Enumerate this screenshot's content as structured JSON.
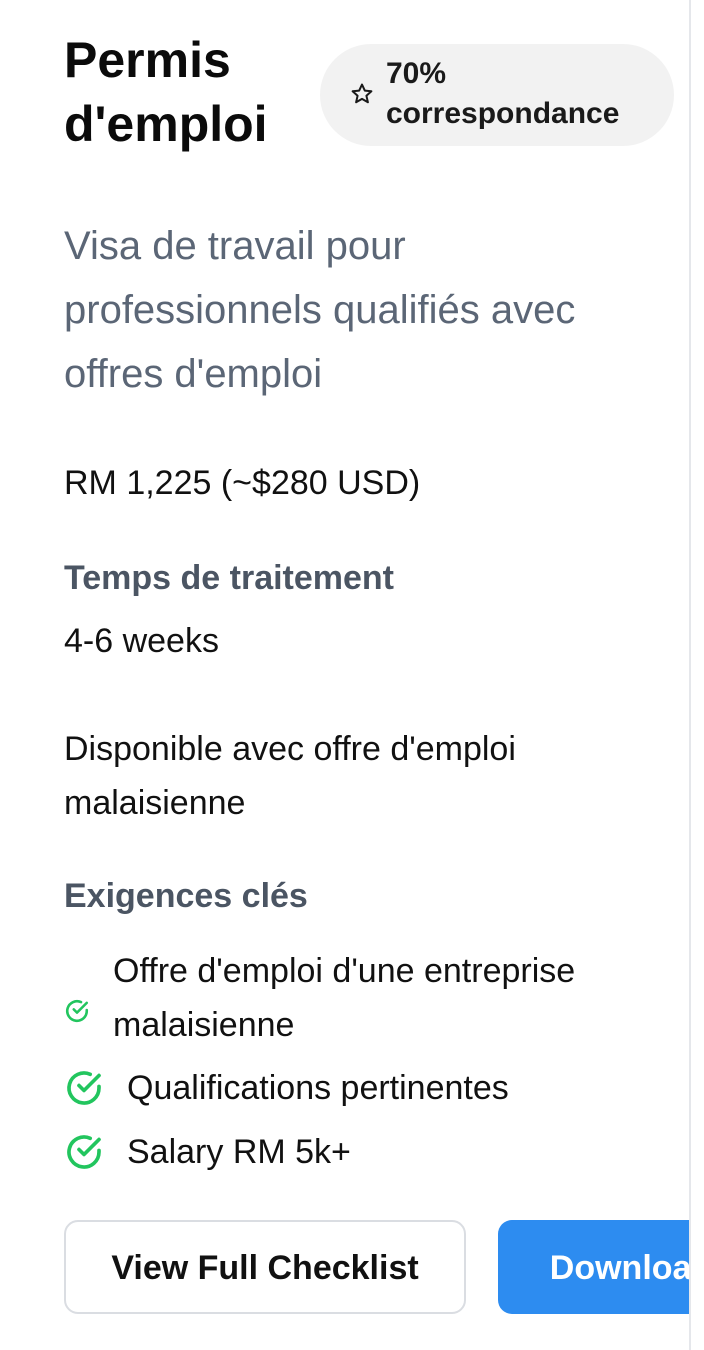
{
  "visa": {
    "title": "Permis d'emploi",
    "match": {
      "percent": "70%",
      "label": "correspondance",
      "icon": "star-icon"
    },
    "description": "Visa de travail pour professionnels qualifiés avec offres d'emploi",
    "cost": "RM 1,225 (~$280 USD)",
    "processing": {
      "label": "Temps de traitement",
      "value": "4-6 weeks"
    },
    "availability": "Disponible avec offre d'emploi malaisienne",
    "requirements": {
      "label": "Exigences clés",
      "icon": "check-circle-icon",
      "items": [
        "Offre d'emploi d'une entreprise malaisienne",
        "Qualifications pertinentes",
        "Salary RM 5k+"
      ]
    }
  },
  "actions": {
    "checklist_label": "View Full Checklist",
    "download_label": "Download"
  },
  "colors": {
    "accent": "#2d8cf0",
    "check": "#22c55e",
    "badge_bg": "#f2f2f2",
    "muted_text": "#5b6676"
  }
}
